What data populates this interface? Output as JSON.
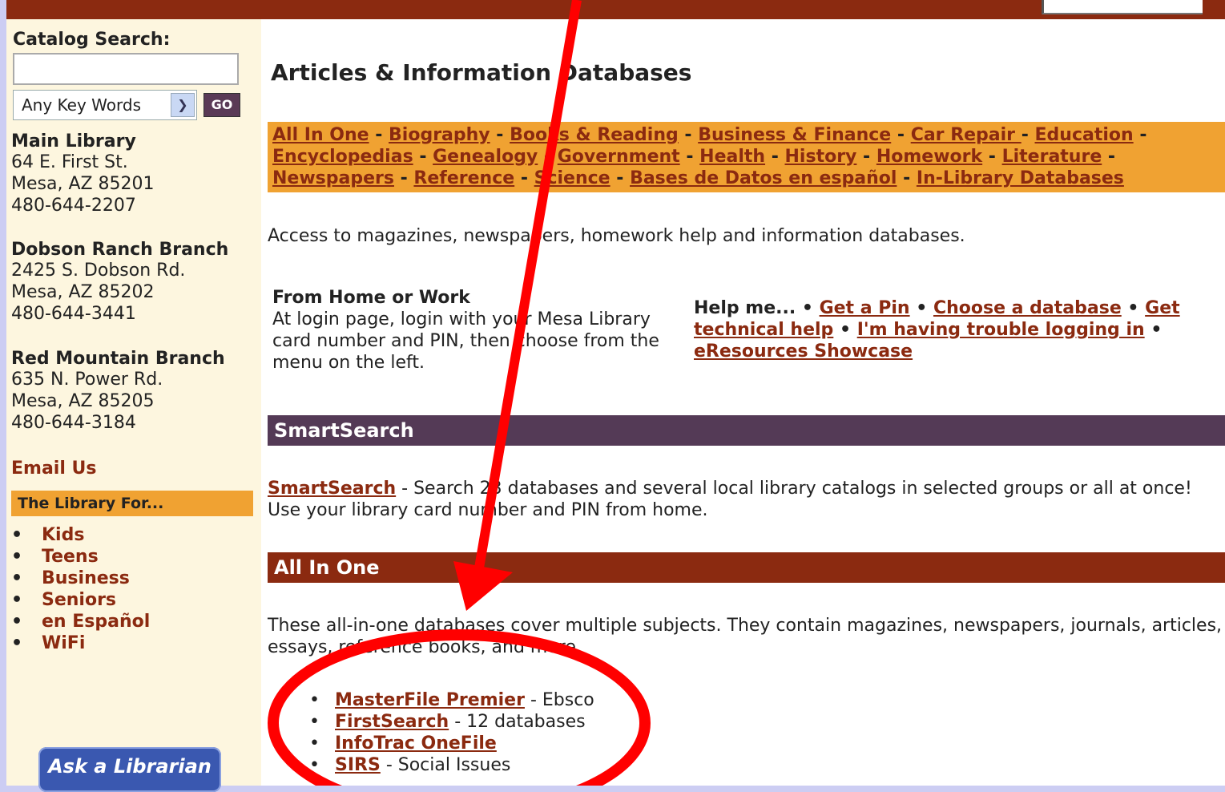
{
  "sidebar": {
    "catalog_label": "Catalog Search:",
    "catalog_input_value": "",
    "search_type": "Any Key Words",
    "go_label": "GO",
    "branches": [
      {
        "name": "Main Library",
        "street": "64 E. First St.",
        "city": "Mesa, AZ 85201",
        "phone": "480-644-2207"
      },
      {
        "name": "Dobson Ranch Branch",
        "street": "2425 S. Dobson Rd.",
        "city": "Mesa, AZ 85202",
        "phone": "480-644-3441"
      },
      {
        "name": "Red Mountain Branch",
        "street": "635 N. Power Rd.",
        "city": "Mesa, AZ 85205",
        "phone": "480-644-3184"
      }
    ],
    "email_label": "Email Us",
    "library_for_label": "The Library For...",
    "library_for_items": [
      "Kids",
      "Teens",
      "Business",
      "Seniors",
      "en Español",
      "WiFi"
    ],
    "ask_label": "Ask a Librarian"
  },
  "main": {
    "title": "Articles & Information Databases",
    "categories": [
      "All In One",
      "Biography",
      "Books & Reading",
      "Business & Finance",
      "Car Repair ",
      "Education",
      "Encyclopedias",
      "Genealogy",
      "Government",
      "Health",
      "History",
      "Homework",
      "Literature",
      "Newspapers",
      "Reference",
      "Science",
      "Bases de Datos en español",
      "In-Library Databases"
    ],
    "intro": "Access to magazines, newspapers, homework help and information databases.",
    "from_home": {
      "heading": "From Home or Work",
      "text": "At login page, login with your Mesa Library card number and PIN, then choose from the menu on the left."
    },
    "help": {
      "prefix": "Help me... • ",
      "links": [
        "Get a Pin",
        "Choose a database",
        "Get technical help",
        "I'm having trouble logging in",
        "eResources Showcase"
      ]
    },
    "smartsearch": {
      "heading": "SmartSearch",
      "link": "SmartSearch",
      "text": " - Search 23 databases and several local library catalogs in selected groups or all at once! Use your library card number and PIN from home."
    },
    "all_in_one": {
      "heading": "All In One",
      "text": "These all-in-one databases cover multiple subjects. They contain magazines, newspapers, journals, articles, essays, reference books, and more",
      "items": [
        {
          "name": "MasterFile Premier",
          "note": " - Ebsco"
        },
        {
          "name": "FirstSearch",
          "note": " - 12 databases"
        },
        {
          "name": "InfoTrac OneFile",
          "note": ""
        },
        {
          "name": "SIRS",
          "note": " - Social Issues"
        }
      ]
    }
  },
  "annotation": {
    "color": "#ff0000"
  }
}
